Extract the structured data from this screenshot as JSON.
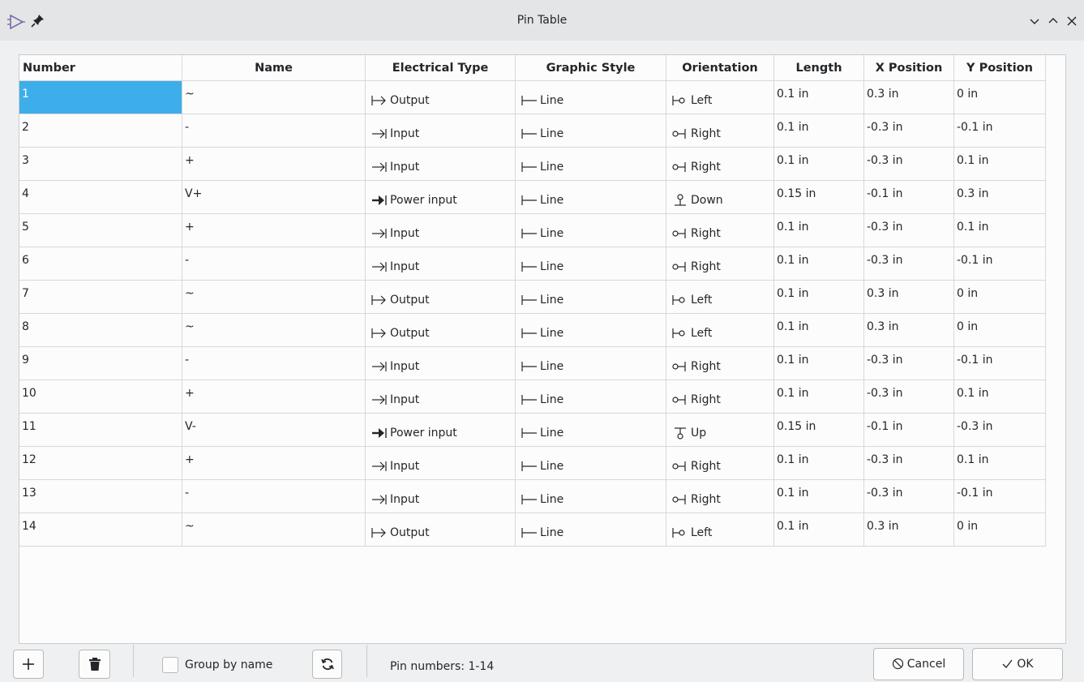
{
  "window": {
    "title": "Pin Table",
    "app_icon": "symbol-editor-icon",
    "pin_icon": "pin-icon",
    "controls": [
      "chevron-down-icon",
      "chevron-up-icon",
      "close-icon"
    ]
  },
  "table": {
    "columns": [
      "Number",
      "Name",
      "Electrical Type",
      "Graphic Style",
      "Orientation",
      "Length",
      "X Position",
      "Y Position"
    ],
    "rows": [
      {
        "number": "1",
        "name": "~",
        "etype": "Output",
        "etype_icon": "output",
        "style": "Line",
        "orient": "Left",
        "orient_icon": "left",
        "length": "0.1 in",
        "x": "0.3 in",
        "y": "0 in"
      },
      {
        "number": "2",
        "name": "-",
        "etype": "Input",
        "etype_icon": "input",
        "style": "Line",
        "orient": "Right",
        "orient_icon": "right",
        "length": "0.1 in",
        "x": "-0.3 in",
        "y": "-0.1 in"
      },
      {
        "number": "3",
        "name": "+",
        "etype": "Input",
        "etype_icon": "input",
        "style": "Line",
        "orient": "Right",
        "orient_icon": "right",
        "length": "0.1 in",
        "x": "-0.3 in",
        "y": "0.1 in"
      },
      {
        "number": "4",
        "name": "V+",
        "etype": "Power input",
        "etype_icon": "power",
        "style": "Line",
        "orient": "Down",
        "orient_icon": "down",
        "length": "0.15 in",
        "x": "-0.1 in",
        "y": "0.3 in"
      },
      {
        "number": "5",
        "name": "+",
        "etype": "Input",
        "etype_icon": "input",
        "style": "Line",
        "orient": "Right",
        "orient_icon": "right",
        "length": "0.1 in",
        "x": "-0.3 in",
        "y": "0.1 in"
      },
      {
        "number": "6",
        "name": "-",
        "etype": "Input",
        "etype_icon": "input",
        "style": "Line",
        "orient": "Right",
        "orient_icon": "right",
        "length": "0.1 in",
        "x": "-0.3 in",
        "y": "-0.1 in"
      },
      {
        "number": "7",
        "name": "~",
        "etype": "Output",
        "etype_icon": "output",
        "style": "Line",
        "orient": "Left",
        "orient_icon": "left",
        "length": "0.1 in",
        "x": "0.3 in",
        "y": "0 in"
      },
      {
        "number": "8",
        "name": "~",
        "etype": "Output",
        "etype_icon": "output",
        "style": "Line",
        "orient": "Left",
        "orient_icon": "left",
        "length": "0.1 in",
        "x": "0.3 in",
        "y": "0 in"
      },
      {
        "number": "9",
        "name": "-",
        "etype": "Input",
        "etype_icon": "input",
        "style": "Line",
        "orient": "Right",
        "orient_icon": "right",
        "length": "0.1 in",
        "x": "-0.3 in",
        "y": "-0.1 in"
      },
      {
        "number": "10",
        "name": "+",
        "etype": "Input",
        "etype_icon": "input",
        "style": "Line",
        "orient": "Right",
        "orient_icon": "right",
        "length": "0.1 in",
        "x": "-0.3 in",
        "y": "0.1 in"
      },
      {
        "number": "11",
        "name": "V-",
        "etype": "Power input",
        "etype_icon": "power",
        "style": "Line",
        "orient": "Up",
        "orient_icon": "up",
        "length": "0.15 in",
        "x": "-0.1 in",
        "y": "-0.3 in"
      },
      {
        "number": "12",
        "name": "+",
        "etype": "Input",
        "etype_icon": "input",
        "style": "Line",
        "orient": "Right",
        "orient_icon": "right",
        "length": "0.1 in",
        "x": "-0.3 in",
        "y": "0.1 in"
      },
      {
        "number": "13",
        "name": "-",
        "etype": "Input",
        "etype_icon": "input",
        "style": "Line",
        "orient": "Right",
        "orient_icon": "right",
        "length": "0.1 in",
        "x": "-0.3 in",
        "y": "-0.1 in"
      },
      {
        "number": "14",
        "name": "~",
        "etype": "Output",
        "etype_icon": "output",
        "style": "Line",
        "orient": "Left",
        "orient_icon": "left",
        "length": "0.1 in",
        "x": "0.3 in",
        "y": "0 in"
      }
    ],
    "selected_row": 0,
    "selected_color": "#3daee9"
  },
  "footer": {
    "group_by_name_label": "Group by name",
    "group_by_name_checked": false,
    "status": "Pin numbers: 1-14",
    "cancel_label": "Cancel",
    "ok_label": "OK"
  }
}
